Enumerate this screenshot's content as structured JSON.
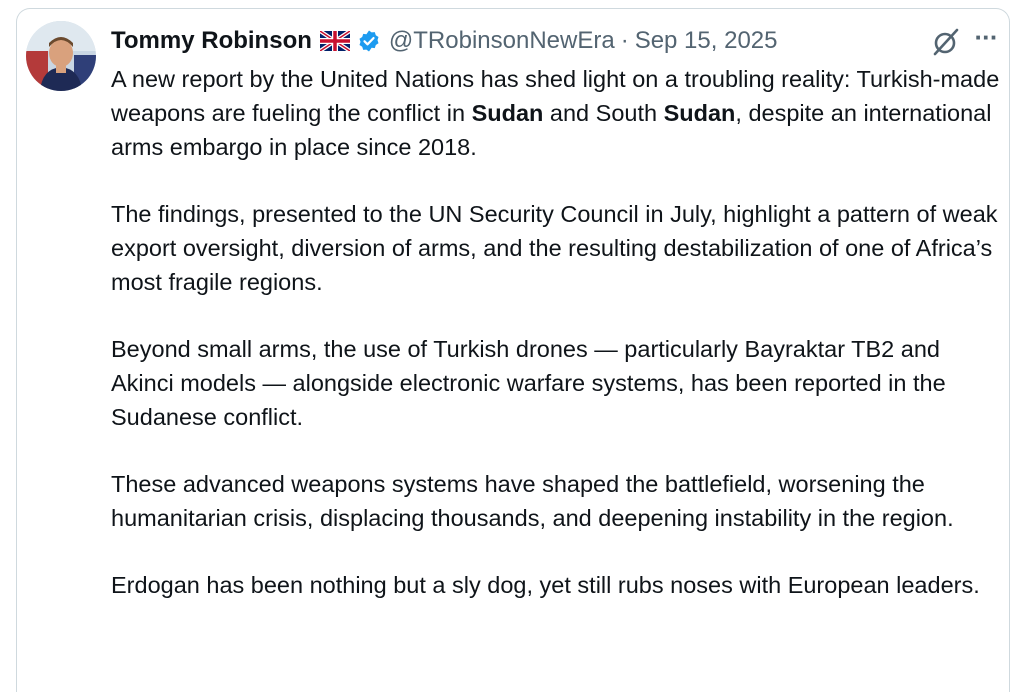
{
  "post": {
    "author": {
      "name": "Tommy Robinson",
      "handle": "@TRobinsonNewEra",
      "flag_icon": "uk-flag-icon",
      "verified_icon": "verified-badge-icon",
      "avatar": "profile-photo"
    },
    "separator": "·",
    "date": "Sep 15, 2025",
    "actions": {
      "grok_icon": "grok-icon",
      "more_label": "···"
    },
    "body": {
      "p1": {
        "a": "A new report by the United Nations has shed light on a troubling reality: Turkish-made weapons are fueling the conflict in ",
        "b": "Sudan",
        "c": " and South ",
        "d": "Sudan",
        "e": ", despite an international arms embargo in place since 2018."
      },
      "p2": "The findings, presented to the UN Security Council in July, highlight a pattern of weak export oversight, diversion of arms, and the resulting destabilization of one of Africa’s most fragile regions.",
      "p3": "Beyond small arms, the use of Turkish drones — particularly Bayraktar TB2 and Akinci models — alongside electronic warfare systems, has been reported in the Sudanese conflict.",
      "p4": "These advanced weapons systems have shaped the battlefield, worsening the humanitarian crisis, displacing thousands, and deepening instability in the region.",
      "p5": "Erdogan has been nothing but a sly dog, yet still rubs noses with European leaders."
    }
  },
  "colors": {
    "text": "#0f1419",
    "secondary": "#536471",
    "verified": "#1d9bf0",
    "border": "#cfd9de"
  }
}
